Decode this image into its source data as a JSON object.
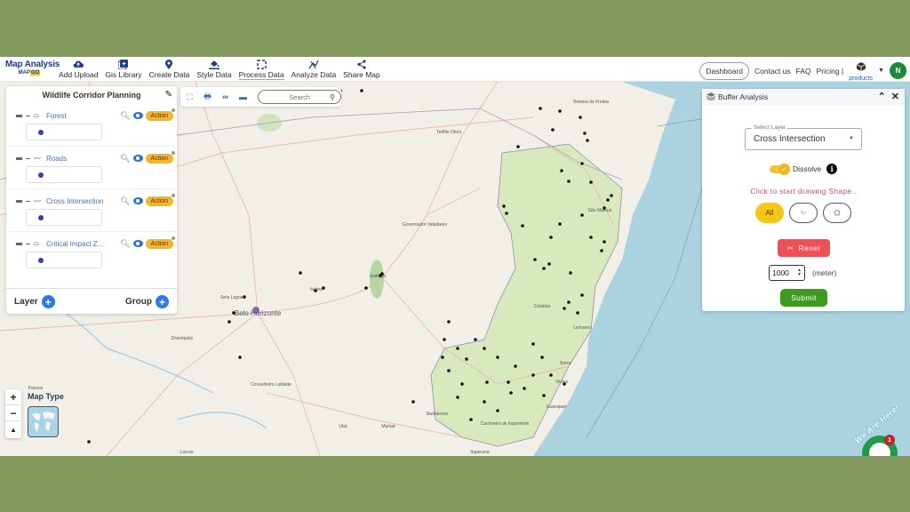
{
  "navbar": {
    "brand_title": "Map Analysis",
    "brand_sub_prefix": "MAP",
    "brand_sub_suffix": "GO",
    "items": [
      {
        "label": "Add Upload",
        "icon": "cloud-upload-icon"
      },
      {
        "label": "Gis Library",
        "icon": "library-icon"
      },
      {
        "label": "Create Data",
        "icon": "map-pin-icon"
      },
      {
        "label": "Style Data",
        "icon": "paint-bucket-icon"
      },
      {
        "label": "Process Data",
        "icon": "process-icon",
        "active": true
      },
      {
        "label": "Analyze Data",
        "icon": "analyze-icon"
      },
      {
        "label": "Share Map",
        "icon": "share-icon"
      }
    ],
    "dashboard": "Dashboard",
    "contact": "Contact us",
    "faq": "FAQ",
    "pricing": "Pricing |",
    "products": "products",
    "avatar_initial": "N"
  },
  "layer_panel": {
    "title": "Wildlife Corridor Planning",
    "layers": [
      {
        "name": "Forest",
        "geometry": "polygon",
        "action": "Action",
        "legend_color": "#2c3fc0"
      },
      {
        "name": "Roads",
        "geometry": "line",
        "action": "Action",
        "legend_color": "#2c3fc0"
      },
      {
        "name": "Cross Intersection",
        "geometry": "line",
        "action": "Action",
        "legend_color": "#2c3fc0"
      },
      {
        "name": "Critical Impact Z...",
        "geometry": "polygon",
        "action": "Action",
        "legend_color": "#2c3fc0"
      }
    ],
    "add_layer": "Layer",
    "add_group": "Group"
  },
  "map_toolbar": {
    "search_placeholder": "Search"
  },
  "buffer_panel": {
    "title": "Buffer Analysis",
    "select_layer_label": "Select Layer",
    "select_layer_value": "Cross Intersection",
    "dissolve_label": "Dissolve",
    "dissolve_on": true,
    "draw_hint": "Click to start drawing Shape..",
    "shape_all": "All",
    "reset": "Reset",
    "distance_value": "1000",
    "distance_unit": "(meter)",
    "submit": "Submit"
  },
  "map": {
    "map_type_label": "Map Type",
    "place_labels": [
      {
        "text": "Teixeira de Freitas"
      },
      {
        "text": "Teófilo Otoni"
      },
      {
        "text": "São Mateus"
      },
      {
        "text": "Governador Valadares"
      },
      {
        "text": "Ipatinga"
      },
      {
        "text": "Itabira"
      },
      {
        "text": "Sete Lagoas"
      },
      {
        "text": "Belo Horizonte"
      },
      {
        "text": "Colatina"
      },
      {
        "text": "Linhares"
      },
      {
        "text": "Serra"
      },
      {
        "text": "Vitória"
      },
      {
        "text": "Guarapari"
      },
      {
        "text": "Cachoeiro de Itapemirim"
      },
      {
        "text": "Divinópolis"
      },
      {
        "text": "Conselheiro Lafaiete"
      },
      {
        "text": "Barbacena"
      },
      {
        "text": "Lavras"
      },
      {
        "text": "Muriaé"
      },
      {
        "text": "Ubá"
      },
      {
        "text": "Itaperuna"
      },
      {
        "text": "Passos"
      }
    ]
  },
  "widget": {
    "text": "We Are Here!",
    "badge_count": "1"
  }
}
